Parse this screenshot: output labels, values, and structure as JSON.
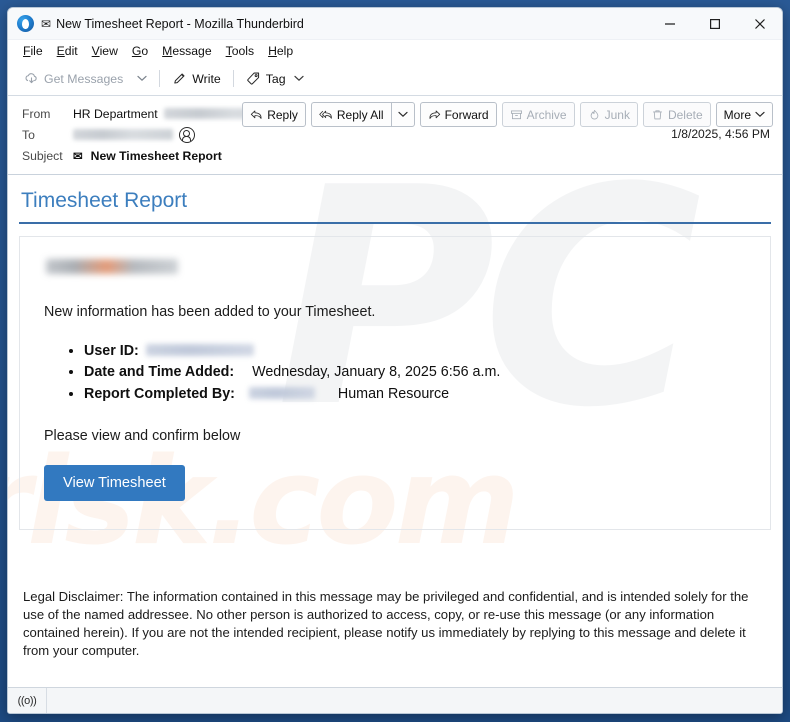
{
  "window": {
    "title": "New Timesheet Report - Mozilla Thunderbird",
    "app_icon": "thunderbird-logo",
    "mail_glyph": "✉",
    "controls": {
      "minimize": "minimize-icon",
      "maximize": "maximize-icon",
      "close": "close-icon"
    }
  },
  "menubar": {
    "items": [
      {
        "label": "File",
        "accesskey": "F"
      },
      {
        "label": "Edit",
        "accesskey": "E"
      },
      {
        "label": "View",
        "accesskey": "V"
      },
      {
        "label": "Go",
        "accesskey": "G"
      },
      {
        "label": "Message",
        "accesskey": "M"
      },
      {
        "label": "Tools",
        "accesskey": "T"
      },
      {
        "label": "Help",
        "accesskey": "H"
      }
    ]
  },
  "toolbar": {
    "get_messages": "Get Messages",
    "get_messages_disabled": true,
    "write": "Write",
    "tag": "Tag"
  },
  "message_header": {
    "from_label": "From",
    "from_name": "HR Department",
    "from_address_redacted": true,
    "to_label": "To",
    "to_redacted": true,
    "subject_label": "Subject",
    "subject": "New Timesheet Report",
    "date": "1/8/2025, 4:56 PM",
    "actions": [
      {
        "label": "Reply",
        "icon": "reply-icon",
        "disabled": false
      },
      {
        "label": "Reply All",
        "icon": "reply-all-icon",
        "disabled": false
      },
      {
        "label": "Forward",
        "icon": "forward-icon",
        "disabled": false
      },
      {
        "label": "Archive",
        "icon": "archive-icon",
        "disabled": true
      },
      {
        "label": "Junk",
        "icon": "junk-icon",
        "disabled": true
      },
      {
        "label": "Delete",
        "icon": "trash-icon",
        "disabled": true
      },
      {
        "label": "More",
        "icon": "chevron-down-icon",
        "disabled": false
      }
    ]
  },
  "email": {
    "heading": "Timesheet Report",
    "intro": "New information has been added to your Timesheet.",
    "facts": [
      {
        "label": "User ID:",
        "value": "",
        "value_redacted": true
      },
      {
        "label": "Date and Time Added:",
        "value": "Wednesday, January 8, 2025 6:56 a.m.",
        "value_redacted": false
      },
      {
        "label": "Report Completed By:",
        "value": "Human Resource",
        "value_redacted": true
      }
    ],
    "confirm_line": "Please view and confirm below",
    "cta_label": "View Timesheet",
    "cta_color": "#3279c0",
    "heading_color": "#3c7ebe",
    "disclaimer": "Legal Disclaimer: The information contained in this message may be privileged and confidential, and is intended solely for the use of the named addressee. No other person is authorized to access, copy, or re-use this message (or any information contained herein). If you are not the intended recipient, please notify us immediately by replying to this message and delete it from your computer."
  },
  "watermark": {
    "primary": "PC",
    "secondary": "risk.com"
  },
  "statusbar": {
    "online_icon": "((o))"
  }
}
